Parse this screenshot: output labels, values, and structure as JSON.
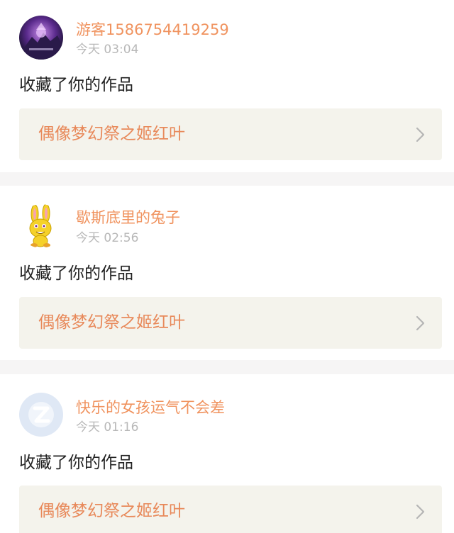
{
  "accent_color": "#f0935f",
  "notifications": [
    {
      "username": "游客1586754419259",
      "time": "今天 03:04",
      "action": "收藏了你的作品",
      "work_title": "偶像梦幻祭之姬红叶",
      "avatar": "purple-fantasy-avatar"
    },
    {
      "username": "歇斯底里的兔子",
      "time": "今天 02:56",
      "action": "收藏了你的作品",
      "work_title": "偶像梦幻祭之姬红叶",
      "avatar": "yellow-rabbit-avatar"
    },
    {
      "username": "快乐的女孩运气不会差",
      "time": "今天 01:16",
      "action": "收藏了你的作品",
      "work_title": "偶像梦幻祭之姬红叶",
      "avatar": "default-qq-avatar"
    }
  ],
  "icons": {
    "chevron": "chevron-right-icon"
  }
}
